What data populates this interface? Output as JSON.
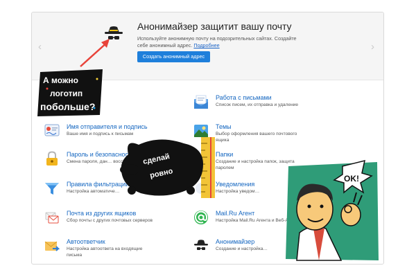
{
  "promo": {
    "title": "Анонимайзер защитит вашу почту",
    "desc_text": "Используйте анонимную почту на подозрительных сайтах. Создайте себе анонимный адрес.",
    "desc_link": "Подробнее",
    "button_label": "Создать анонимный адрес",
    "prev_glyph": "‹",
    "next_glyph": "›",
    "icon": "incognito-spy-icon"
  },
  "settings_left": [
    {
      "title": "",
      "desc": "",
      "icon": "hidden"
    },
    {
      "title": "Имя отправителя и подпись",
      "desc": "Ваше имя и подпись к письмам",
      "icon": "signature-icon"
    },
    {
      "title": "Пароль и безопасность",
      "desc": "Смена пароля, дан… восстановления",
      "icon": "lock-icon"
    },
    {
      "title": "Правила фильтрации",
      "desc": "Настройка автоматиче…",
      "icon": "funnel-icon"
    },
    {
      "title": "Почта из других ящиков",
      "desc": "Сбор почты с других почтовых серверов",
      "icon": "mail-collector-icon"
    },
    {
      "title": "Автоответчик",
      "desc": "Настройка автоответа на входящие письма",
      "icon": "envelope-reply-icon"
    }
  ],
  "settings_right": [
    {
      "title": "Работа с письмами",
      "desc": "Список писем, их отправка и удаление",
      "icon": "letter-icon"
    },
    {
      "title": "Темы",
      "desc": "Выбор оформления вашего почтового ящика",
      "icon": "picture-icon"
    },
    {
      "title": "Папки",
      "desc": "Создание и настройка папок, защита паролем",
      "icon": "folder-icon"
    },
    {
      "title": "Уведомления",
      "desc": "Настройка уведом…",
      "icon": "bell-icon"
    },
    {
      "title": "Mail.Ru Агент",
      "desc": "Настройка Mail.Ru Агента и Веб-А…",
      "icon": "at-sign-icon"
    },
    {
      "title": "Анонимайзер",
      "desc": "Создание и настройка…",
      "icon": "incognito-spy-icon"
    }
  ],
  "stickers": {
    "logo_sticker_lines": [
      "А можно",
      "логотип",
      "побольше?"
    ],
    "cat_sticker_lines": [
      "сделай",
      "ровно"
    ],
    "ok_bubble": "OK!"
  },
  "colors": {
    "link_blue": "#1466c0",
    "button_blue": "#1e7fdb",
    "annotation_red": "#e8433a",
    "comic_yellow": "#f7d23a",
    "comic_green": "#2f9c78"
  }
}
